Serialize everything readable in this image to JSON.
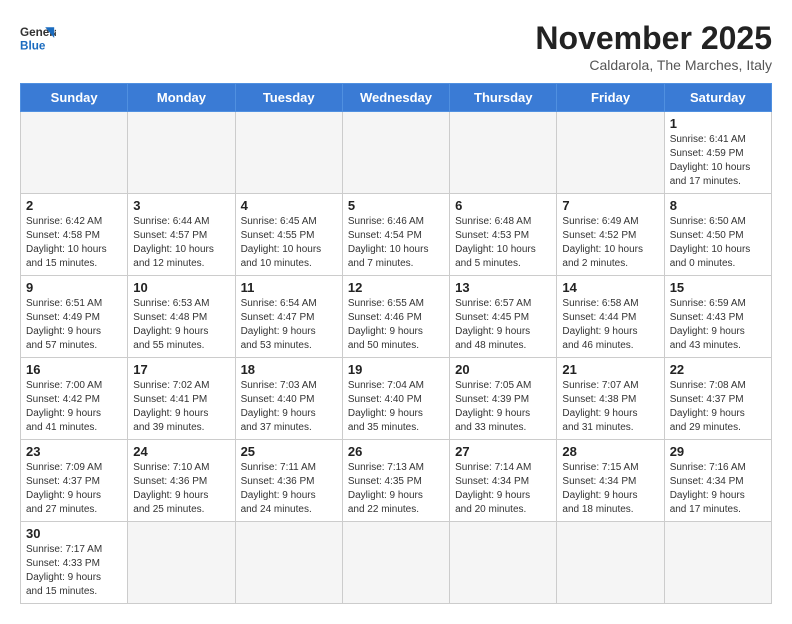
{
  "logo": {
    "line1": "General",
    "line2": "Blue"
  },
  "title": "November 2025",
  "subtitle": "Caldarola, The Marches, Italy",
  "weekdays": [
    "Sunday",
    "Monday",
    "Tuesday",
    "Wednesday",
    "Thursday",
    "Friday",
    "Saturday"
  ],
  "days": [
    {
      "num": "",
      "info": ""
    },
    {
      "num": "",
      "info": ""
    },
    {
      "num": "",
      "info": ""
    },
    {
      "num": "",
      "info": ""
    },
    {
      "num": "",
      "info": ""
    },
    {
      "num": "",
      "info": ""
    },
    {
      "num": "1",
      "info": "Sunrise: 6:41 AM\nSunset: 4:59 PM\nDaylight: 10 hours\nand 17 minutes."
    },
    {
      "num": "2",
      "info": "Sunrise: 6:42 AM\nSunset: 4:58 PM\nDaylight: 10 hours\nand 15 minutes."
    },
    {
      "num": "3",
      "info": "Sunrise: 6:44 AM\nSunset: 4:57 PM\nDaylight: 10 hours\nand 12 minutes."
    },
    {
      "num": "4",
      "info": "Sunrise: 6:45 AM\nSunset: 4:55 PM\nDaylight: 10 hours\nand 10 minutes."
    },
    {
      "num": "5",
      "info": "Sunrise: 6:46 AM\nSunset: 4:54 PM\nDaylight: 10 hours\nand 7 minutes."
    },
    {
      "num": "6",
      "info": "Sunrise: 6:48 AM\nSunset: 4:53 PM\nDaylight: 10 hours\nand 5 minutes."
    },
    {
      "num": "7",
      "info": "Sunrise: 6:49 AM\nSunset: 4:52 PM\nDaylight: 10 hours\nand 2 minutes."
    },
    {
      "num": "8",
      "info": "Sunrise: 6:50 AM\nSunset: 4:50 PM\nDaylight: 10 hours\nand 0 minutes."
    },
    {
      "num": "9",
      "info": "Sunrise: 6:51 AM\nSunset: 4:49 PM\nDaylight: 9 hours\nand 57 minutes."
    },
    {
      "num": "10",
      "info": "Sunrise: 6:53 AM\nSunset: 4:48 PM\nDaylight: 9 hours\nand 55 minutes."
    },
    {
      "num": "11",
      "info": "Sunrise: 6:54 AM\nSunset: 4:47 PM\nDaylight: 9 hours\nand 53 minutes."
    },
    {
      "num": "12",
      "info": "Sunrise: 6:55 AM\nSunset: 4:46 PM\nDaylight: 9 hours\nand 50 minutes."
    },
    {
      "num": "13",
      "info": "Sunrise: 6:57 AM\nSunset: 4:45 PM\nDaylight: 9 hours\nand 48 minutes."
    },
    {
      "num": "14",
      "info": "Sunrise: 6:58 AM\nSunset: 4:44 PM\nDaylight: 9 hours\nand 46 minutes."
    },
    {
      "num": "15",
      "info": "Sunrise: 6:59 AM\nSunset: 4:43 PM\nDaylight: 9 hours\nand 43 minutes."
    },
    {
      "num": "16",
      "info": "Sunrise: 7:00 AM\nSunset: 4:42 PM\nDaylight: 9 hours\nand 41 minutes."
    },
    {
      "num": "17",
      "info": "Sunrise: 7:02 AM\nSunset: 4:41 PM\nDaylight: 9 hours\nand 39 minutes."
    },
    {
      "num": "18",
      "info": "Sunrise: 7:03 AM\nSunset: 4:40 PM\nDaylight: 9 hours\nand 37 minutes."
    },
    {
      "num": "19",
      "info": "Sunrise: 7:04 AM\nSunset: 4:40 PM\nDaylight: 9 hours\nand 35 minutes."
    },
    {
      "num": "20",
      "info": "Sunrise: 7:05 AM\nSunset: 4:39 PM\nDaylight: 9 hours\nand 33 minutes."
    },
    {
      "num": "21",
      "info": "Sunrise: 7:07 AM\nSunset: 4:38 PM\nDaylight: 9 hours\nand 31 minutes."
    },
    {
      "num": "22",
      "info": "Sunrise: 7:08 AM\nSunset: 4:37 PM\nDaylight: 9 hours\nand 29 minutes."
    },
    {
      "num": "23",
      "info": "Sunrise: 7:09 AM\nSunset: 4:37 PM\nDaylight: 9 hours\nand 27 minutes."
    },
    {
      "num": "24",
      "info": "Sunrise: 7:10 AM\nSunset: 4:36 PM\nDaylight: 9 hours\nand 25 minutes."
    },
    {
      "num": "25",
      "info": "Sunrise: 7:11 AM\nSunset: 4:36 PM\nDaylight: 9 hours\nand 24 minutes."
    },
    {
      "num": "26",
      "info": "Sunrise: 7:13 AM\nSunset: 4:35 PM\nDaylight: 9 hours\nand 22 minutes."
    },
    {
      "num": "27",
      "info": "Sunrise: 7:14 AM\nSunset: 4:34 PM\nDaylight: 9 hours\nand 20 minutes."
    },
    {
      "num": "28",
      "info": "Sunrise: 7:15 AM\nSunset: 4:34 PM\nDaylight: 9 hours\nand 18 minutes."
    },
    {
      "num": "29",
      "info": "Sunrise: 7:16 AM\nSunset: 4:34 PM\nDaylight: 9 hours\nand 17 minutes."
    },
    {
      "num": "30",
      "info": "Sunrise: 7:17 AM\nSunset: 4:33 PM\nDaylight: 9 hours\nand 15 minutes."
    },
    {
      "num": "",
      "info": ""
    },
    {
      "num": "",
      "info": ""
    },
    {
      "num": "",
      "info": ""
    },
    {
      "num": "",
      "info": ""
    },
    {
      "num": "",
      "info": ""
    },
    {
      "num": "",
      "info": ""
    }
  ]
}
